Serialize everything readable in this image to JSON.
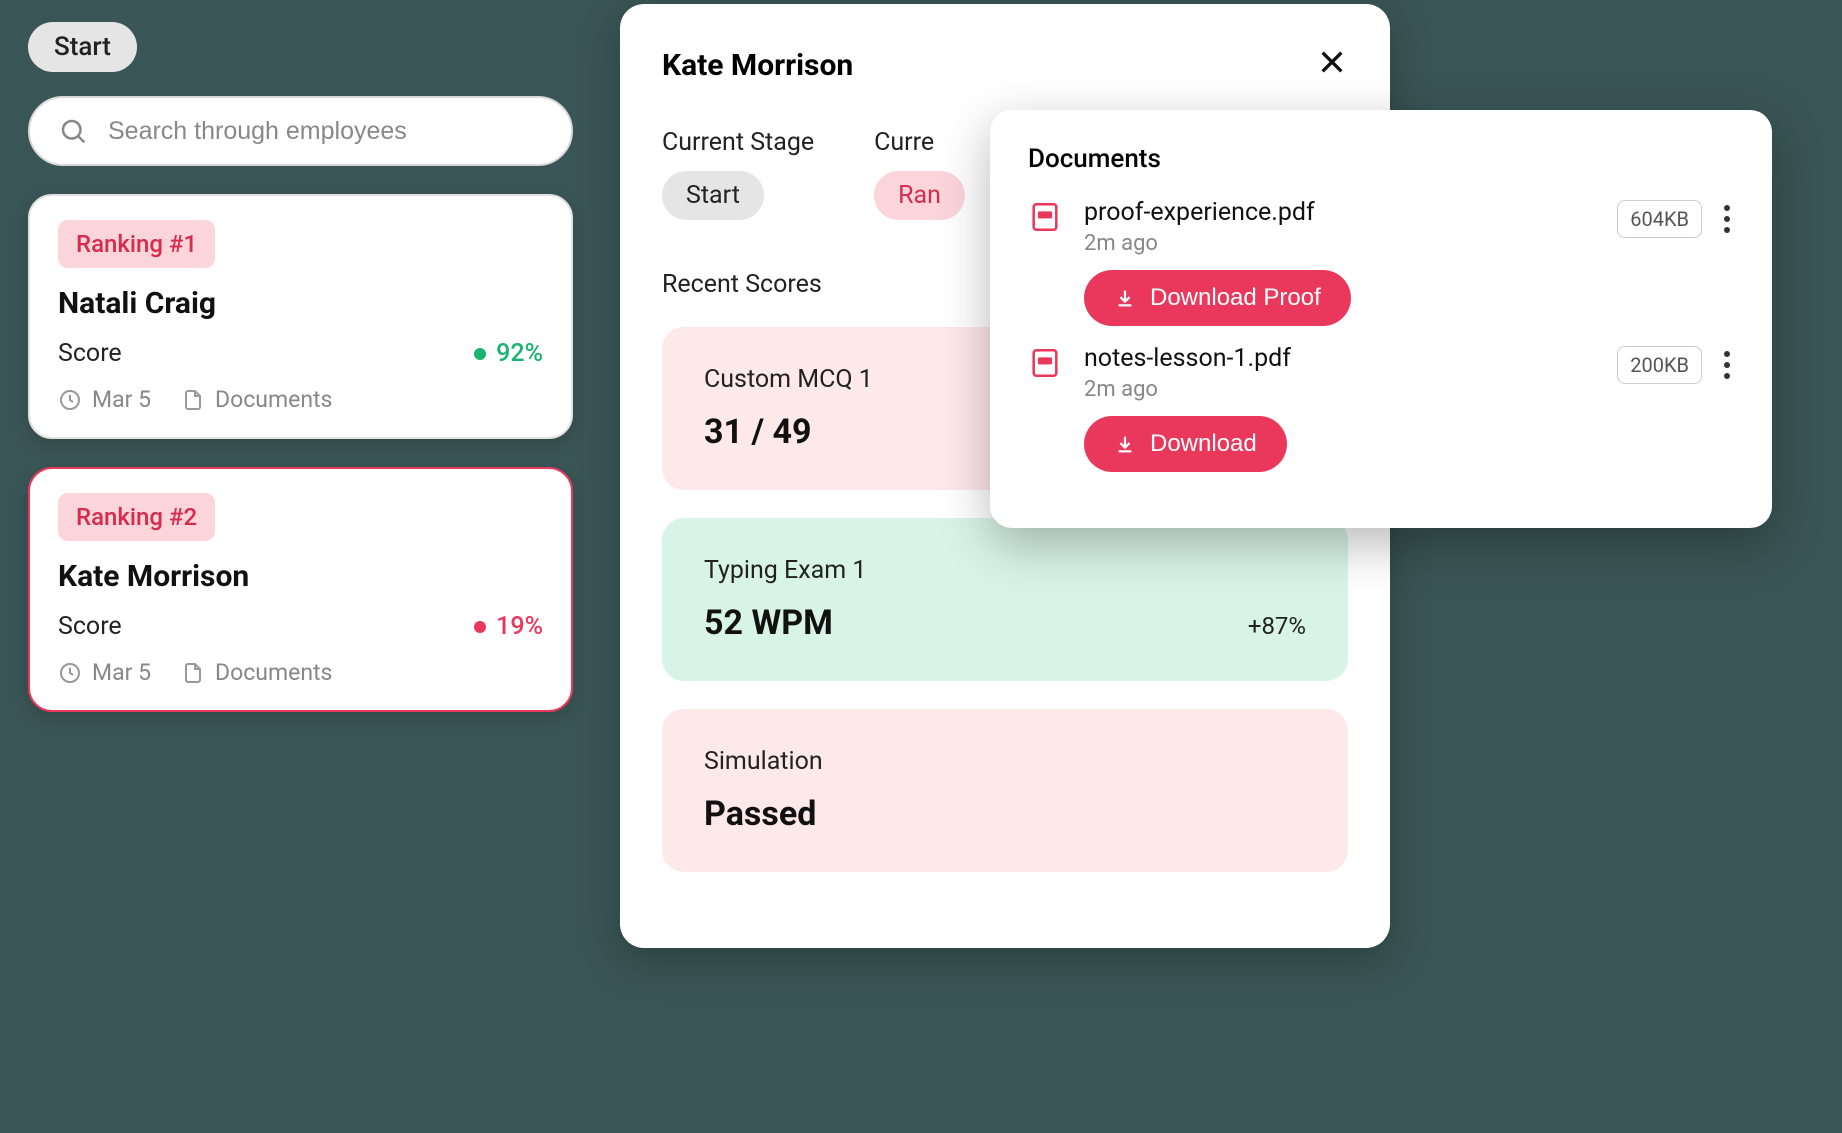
{
  "sidebar": {
    "start_label": "Start",
    "search_placeholder": "Search through employees"
  },
  "employees": [
    {
      "rank": "Ranking #1",
      "name": "Natali Craig",
      "score_label": "Score",
      "score": "92%",
      "score_status": "green",
      "date": "Mar 5",
      "docs_label": "Documents",
      "selected": false
    },
    {
      "rank": "Ranking #2",
      "name": "Kate Morrison",
      "score_label": "Score",
      "score": "19%",
      "score_status": "red",
      "date": "Mar 5",
      "docs_label": "Documents",
      "selected": true
    }
  ],
  "detail": {
    "name": "Kate Morrison",
    "current_stage_label": "Current Stage",
    "current_stage_value": "Start",
    "current_rank_short_label": "Curre",
    "current_rank_short_value": "Ran",
    "recent_scores_label": "Recent Scores",
    "scores": [
      {
        "title": "Custom MCQ 1",
        "value": "31 / 49",
        "extra": "",
        "variant": "pink"
      },
      {
        "title": "Typing Exam 1",
        "value": "52 WPM",
        "extra": "+87%",
        "variant": "green"
      },
      {
        "title": "Simulation",
        "value": "Passed",
        "extra": "",
        "variant": "pink"
      }
    ]
  },
  "documents_popover": {
    "title": "Documents",
    "items": [
      {
        "name": "proof-experience.pdf",
        "time": "2m ago",
        "size": "604KB",
        "button": "Download Proof"
      },
      {
        "name": "notes-lesson-1.pdf",
        "time": "2m ago",
        "size": "200KB",
        "button": "Download"
      }
    ]
  }
}
